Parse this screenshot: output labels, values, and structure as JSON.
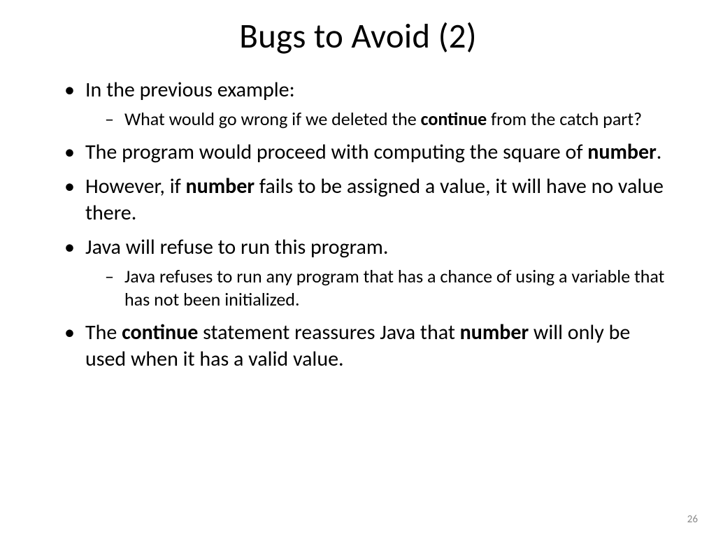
{
  "slide": {
    "title": "Bugs to Avoid (2)",
    "page_number": "26",
    "bullets": {
      "b1": "In the previous example:",
      "b1_sub_pre": "What would go wrong if we deleted the ",
      "b1_sub_bold": "continue",
      "b1_sub_post": " from the catch part?",
      "b2_pre": "The program would proceed with computing the square of ",
      "b2_bold": "number",
      "b2_post": ".",
      "b3_pre": "However, if ",
      "b3_bold": "number",
      "b3_post": " fails to be assigned a value, it will have no value there.",
      "b4": "Java will refuse to run this program.",
      "b4_sub": "Java refuses to run any program that has a chance of using a variable that has not been initialized.",
      "b5_pre": "The ",
      "b5_bold1": "continue",
      "b5_mid": " statement reassures Java that ",
      "b5_bold2": "number",
      "b5_post": " will only be used when it has a valid value."
    }
  }
}
